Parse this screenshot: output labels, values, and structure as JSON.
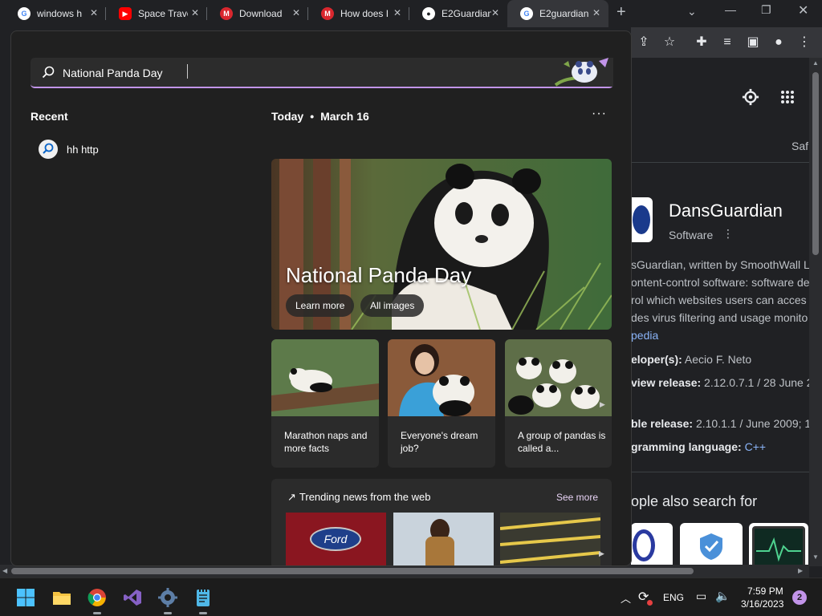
{
  "tabs": [
    {
      "title": "windows h",
      "favicon": "google-icon",
      "color": "#ffffff"
    },
    {
      "title": "Space Trave",
      "favicon": "youtube-icon",
      "color": "#ff0000"
    },
    {
      "title": "Download",
      "favicon": "mega-icon",
      "color": "#d9272e"
    },
    {
      "title": "How does I",
      "favicon": "mega-icon",
      "color": "#d9272e"
    },
    {
      "title": "E2Guardian",
      "favicon": "github-icon",
      "color": "#ffffff"
    },
    {
      "title": "E2guardian",
      "favicon": "google-icon",
      "color": "#ffffff"
    }
  ],
  "search": {
    "value": "National Panda Day"
  },
  "recent": {
    "heading": "Recent",
    "items": [
      {
        "label": "hh http"
      }
    ]
  },
  "today": {
    "heading": "Today",
    "date": "March 16",
    "hero": {
      "title": "National Panda Day",
      "learn_more": "Learn more",
      "all_images": "All images"
    },
    "cards": [
      {
        "caption": "Marathon naps and more facts"
      },
      {
        "caption": "Everyone's dream job?"
      },
      {
        "caption": "A group of pandas is called a..."
      }
    ],
    "trending": {
      "heading": "Trending news from the web",
      "see_more": "See more"
    }
  },
  "knowledge_panel": {
    "tab_partial": "Saf",
    "title": "DansGuardian",
    "subtitle": "Software",
    "desc_lines": [
      "sGuardian, written by SmoothWall L",
      "ontent-control software: software des",
      "rol which websites users can acces",
      "des virus filtering and usage monito"
    ],
    "wiki": "pedia",
    "facts": [
      {
        "label": "eloper(s):",
        "value": " Aecio F. Neto"
      },
      {
        "label": "view release:",
        "value": " 2.12.0.7.1 / 28 June 2"
      },
      {
        "label": "ble release:",
        "value": " 2.10.1.1 / June 2009; 1"
      },
      {
        "label": "gramming language:",
        "value": " C++"
      }
    ],
    "also_search": "ople also search for"
  },
  "taskbar": {
    "lang": "ENG",
    "time": "7:59 PM",
    "date": "3/16/2023",
    "badge": "2"
  },
  "colors": {
    "accent": "#c294e9",
    "link": "#8ab4f8"
  }
}
